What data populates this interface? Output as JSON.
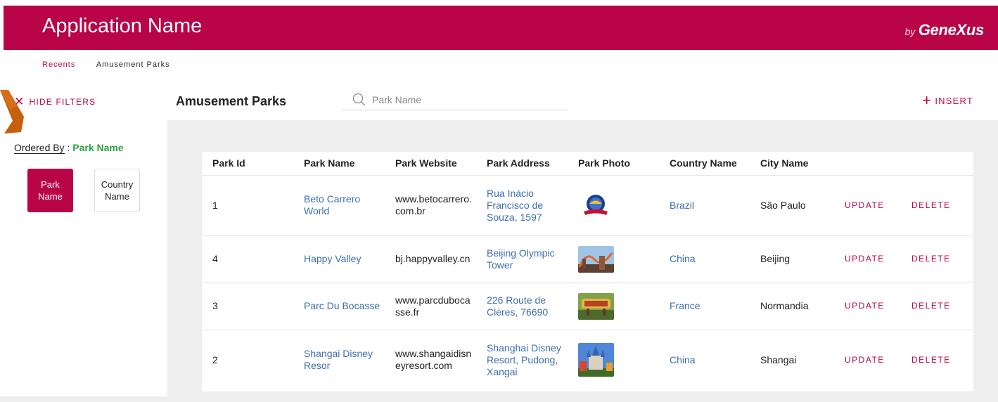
{
  "header": {
    "app_title": "Application Name",
    "brand_by": "by",
    "brand_name": "GeneXus"
  },
  "breadcrumb": {
    "recent": "Recents",
    "current": "Amusement Parks"
  },
  "toolbar": {
    "hide_filters": "HIDE FILTERS",
    "page_title": "Amusement Parks",
    "search_placeholder": "Park Name",
    "insert": "INSERT"
  },
  "filters": {
    "ordered_by_label": "Ordered By",
    "ordered_by_value": "Park Name",
    "options": [
      {
        "line1": "Park",
        "line2": "Name",
        "active": true
      },
      {
        "line1": "Country",
        "line2": "Name",
        "active": false
      }
    ]
  },
  "table": {
    "columns": [
      "Park Id",
      "Park Name",
      "Park Website",
      "Park Address",
      "Park Photo",
      "Country Name",
      "City Name"
    ],
    "update_label": "UPDATE",
    "delete_label": "DELETE",
    "rows": [
      {
        "id": "1",
        "name_l1": "Beto Carrero",
        "name_l2": "World",
        "web_l1": "www.betocarrero.",
        "web_l2": "com.br",
        "addr_l1": "Rua Inácio",
        "addr_l2": "Francisco de",
        "addr_l3": "Souza, 1597",
        "photo": "beto-carrero-logo",
        "country": "Brazil",
        "city": "São Paulo"
      },
      {
        "id": "4",
        "name_l1": "Happy Valley",
        "name_l2": "",
        "web_l1": "bj.happyvalley.cn",
        "web_l2": "",
        "addr_l1": "Beijing Olympic",
        "addr_l2": "Tower",
        "addr_l3": "",
        "photo": "happy-valley-rollercoaster",
        "country": "China",
        "city": "Beijing"
      },
      {
        "id": "3",
        "name_l1": "Parc Du Bocasse",
        "name_l2": "",
        "web_l1": "www.parcduboca",
        "web_l2": "sse.fr",
        "addr_l1": "226 Route de",
        "addr_l2": "Clères, 76690",
        "addr_l3": "",
        "photo": "bocasse-entrance",
        "country": "France",
        "city": "Normandia"
      },
      {
        "id": "2",
        "name_l1": "Shangai Disney",
        "name_l2": "Resor",
        "web_l1": "www.shangaidisn",
        "web_l2": "eyresort.com",
        "addr_l1": "Shanghai Disney",
        "addr_l2": "Resort, Pudong,",
        "addr_l3": "Xangai",
        "photo": "disney-castle",
        "country": "China",
        "city": "Shangai"
      }
    ]
  },
  "colors": {
    "brand": "#b90547",
    "link": "#3c6db0",
    "accent_green": "#2ea043",
    "arrow": "#c65f0e"
  }
}
